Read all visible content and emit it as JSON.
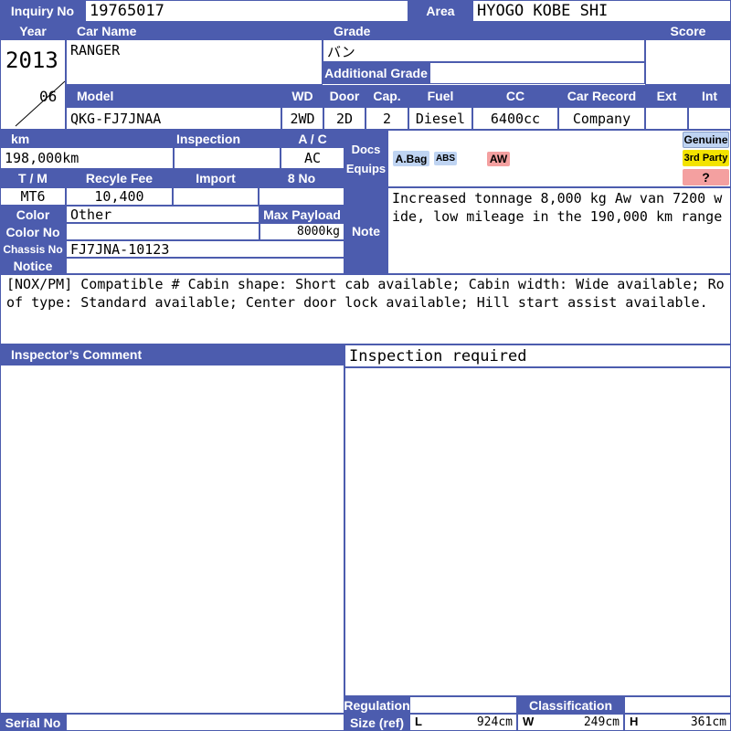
{
  "header": {
    "inquiry_label": "Inquiry No",
    "inquiry_value": "19765017",
    "area_label": "Area",
    "area_value": "HYOGO KOBE SHI"
  },
  "labels": {
    "year": "Year",
    "car_name": "Car Name",
    "grade": "Grade",
    "score": "Score",
    "additional_grade": "Additional Grade",
    "model": "Model",
    "wd": "WD",
    "door": "Door",
    "cap": "Cap.",
    "fuel": "Fuel",
    "cc": "CC",
    "car_record": "Car Record",
    "ext": "Ext",
    "int": "Int",
    "km": "km",
    "inspection": "Inspection",
    "ac": "A / C",
    "docs": "Docs",
    "equips": "Equips",
    "tm": "T / M",
    "recycle_fee": "Recyle Fee",
    "import": "Import",
    "eight_no": "8 No",
    "color": "Color",
    "max_payload": "Max Payload",
    "color_no": "Color No",
    "chassis_no": "Chassis No",
    "notice": "Notice",
    "note": "Note",
    "inspector_comment": "Inspector’s Comment",
    "serial_no": "Serial No",
    "regulation": "Regulation",
    "size_ref": "Size (ref)",
    "classification": "Classification"
  },
  "values": {
    "year": "2013",
    "month": "06",
    "car_name": "RANGER",
    "grade": "バン",
    "additional_grade": "",
    "score": "",
    "model": "QKG-FJ7JNAA",
    "wd": "2WD",
    "door": "2D",
    "cap": "2",
    "fuel": "Diesel",
    "cc": "6400cc",
    "car_record": "Company",
    "ext": "",
    "int": "",
    "km": "198,000km",
    "inspection": "",
    "ac": "AC",
    "tm": "MT6",
    "recycle_fee": "10,400",
    "import": "",
    "eight_no": "",
    "color": "Other",
    "max_payload": "8000kg",
    "color_no": "",
    "chassis_no": "FJ7JNA-10123",
    "note": "Increased tonnage 8,000 kg Aw van 7200 wide, low mileage in the 190,000 km range",
    "notice": "[NOX/PM] Compatible # Cabin shape: Short cab available; Cabin width: Wide available; Roof type: Standard available; Center door lock available; Hill start assist available.",
    "inspector_comment": "Inspection required",
    "serial_no": "",
    "regulation": "",
    "classification": ""
  },
  "equips": {
    "abag": "A.Bag",
    "abs": "ABS",
    "aw": "AW"
  },
  "tags": {
    "genuine": "Genuine",
    "third_party": "3rd Party",
    "unknown": "?"
  },
  "size": {
    "l_label": "L",
    "l_value": "924cm",
    "w_label": "W",
    "w_value": "249cm",
    "h_label": "H",
    "h_value": "361cm"
  },
  "colors": {
    "label_bg": "#4c5cae",
    "abag_bg": "#bfd4f2",
    "abs_bg": "#bfd4f2",
    "aw_bg": "#f4a0a0",
    "genuine_bg": "#bfd4f2",
    "third_party_bg": "#f3e300",
    "unknown_bg": "#f4a0a0"
  }
}
